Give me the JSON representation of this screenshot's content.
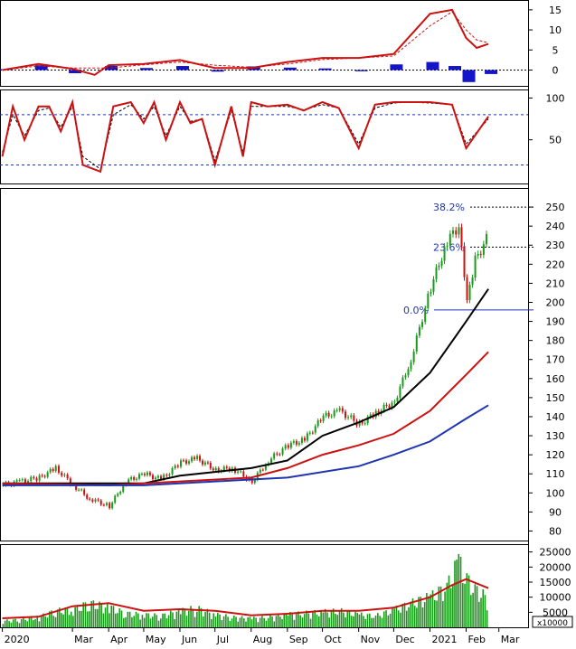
{
  "chart_data": {
    "type": "line",
    "price_panel": {
      "ylim": [
        75,
        260
      ],
      "y_ticks": [
        "80",
        "90",
        "100",
        "110",
        "120",
        "130",
        "140",
        "150",
        "160",
        "170",
        "180",
        "190",
        "200",
        "210",
        "220",
        "230",
        "240",
        "250"
      ],
      "fib_levels": [
        {
          "label": "38.2%",
          "value": 250
        },
        {
          "label": "23.6%",
          "value": 229
        },
        {
          "label": "0.0%",
          "value": 196
        }
      ],
      "candles": [
        {
          "date": "2020-01-01",
          "close": 104
        },
        {
          "date": "2020-01-15",
          "close": 106
        },
        {
          "date": "2020-02-01",
          "close": 108
        },
        {
          "date": "2020-02-15",
          "close": 113
        },
        {
          "date": "2020-03-01",
          "close": 104
        },
        {
          "date": "2020-03-15",
          "close": 97
        },
        {
          "date": "2020-04-01",
          "close": 93
        },
        {
          "date": "2020-04-15",
          "close": 106
        },
        {
          "date": "2020-05-01",
          "close": 110
        },
        {
          "date": "2020-05-15",
          "close": 107
        },
        {
          "date": "2020-06-01",
          "close": 116
        },
        {
          "date": "2020-06-15",
          "close": 118
        },
        {
          "date": "2020-07-01",
          "close": 112
        },
        {
          "date": "2020-07-15",
          "close": 113
        },
        {
          "date": "2020-08-01",
          "close": 106
        },
        {
          "date": "2020-08-15",
          "close": 117
        },
        {
          "date": "2020-09-01",
          "close": 125
        },
        {
          "date": "2020-09-15",
          "close": 128
        },
        {
          "date": "2020-10-01",
          "close": 140
        },
        {
          "date": "2020-10-15",
          "close": 143
        },
        {
          "date": "2020-11-01",
          "close": 136
        },
        {
          "date": "2020-11-15",
          "close": 142
        },
        {
          "date": "2020-12-01",
          "close": 148
        },
        {
          "date": "2020-12-15",
          "close": 170
        },
        {
          "date": "2021-01-01",
          "close": 208
        },
        {
          "date": "2021-01-15",
          "close": 232
        },
        {
          "date": "2021-01-25",
          "close": 240
        },
        {
          "date": "2021-02-01",
          "close": 200
        },
        {
          "date": "2021-02-08",
          "close": 222
        },
        {
          "date": "2021-02-20",
          "close": 236
        }
      ],
      "ma_series": [
        {
          "color": "#000000",
          "points": [
            [
              "2020-01-01",
              105
            ],
            [
              "2020-03-01",
              105
            ],
            [
              "2020-05-01",
              105
            ],
            [
              "2020-06-01",
              109
            ],
            [
              "2020-07-01",
              111
            ],
            [
              "2020-08-01",
              113
            ],
            [
              "2020-09-01",
              117
            ],
            [
              "2020-10-01",
              130
            ],
            [
              "2020-11-01",
              137
            ],
            [
              "2020-12-01",
              145
            ],
            [
              "2021-01-01",
              163
            ],
            [
              "2021-02-01",
              190
            ],
            [
              "2021-02-20",
              207
            ]
          ]
        },
        {
          "color": "#cc1111",
          "points": [
            [
              "2020-01-01",
              105
            ],
            [
              "2020-04-01",
              104
            ],
            [
              "2020-06-01",
              106
            ],
            [
              "2020-08-01",
              108
            ],
            [
              "2020-09-01",
              113
            ],
            [
              "2020-10-01",
              120
            ],
            [
              "2020-11-01",
              125
            ],
            [
              "2020-12-01",
              131
            ],
            [
              "2021-01-01",
              143
            ],
            [
              "2021-02-01",
              162
            ],
            [
              "2021-02-20",
              174
            ]
          ]
        },
        {
          "color": "#1f35b0",
          "points": [
            [
              "2020-01-01",
              104
            ],
            [
              "2020-05-01",
              104
            ],
            [
              "2020-07-01",
              106
            ],
            [
              "2020-09-01",
              108
            ],
            [
              "2020-11-01",
              114
            ],
            [
              "2020-12-01",
              120
            ],
            [
              "2021-01-01",
              127
            ],
            [
              "2021-02-01",
              139
            ],
            [
              "2021-02-20",
              146
            ]
          ]
        }
      ]
    },
    "volume_panel": {
      "unit_label": "x10000",
      "ylim": [
        0,
        27000
      ],
      "y_ticks": [
        "5000",
        "10000",
        "15000",
        "20000",
        "25000"
      ],
      "bars": [
        {
          "date": "2020-01-01",
          "value": 2500
        },
        {
          "date": "2020-01-15",
          "value": 3000
        },
        {
          "date": "2020-02-01",
          "value": 4000
        },
        {
          "date": "2020-02-15",
          "value": 6500
        },
        {
          "date": "2020-03-01",
          "value": 7000
        },
        {
          "date": "2020-03-15",
          "value": 9500
        },
        {
          "date": "2020-04-01",
          "value": 8000
        },
        {
          "date": "2020-04-15",
          "value": 5500
        },
        {
          "date": "2020-05-01",
          "value": 5000
        },
        {
          "date": "2020-05-15",
          "value": 4500
        },
        {
          "date": "2020-06-01",
          "value": 6500
        },
        {
          "date": "2020-06-15",
          "value": 7500
        },
        {
          "date": "2020-07-01",
          "value": 5000
        },
        {
          "date": "2020-07-15",
          "value": 4000
        },
        {
          "date": "2020-08-01",
          "value": 3500
        },
        {
          "date": "2020-08-15",
          "value": 4000
        },
        {
          "date": "2020-09-01",
          "value": 5000
        },
        {
          "date": "2020-09-15",
          "value": 5500
        },
        {
          "date": "2020-10-01",
          "value": 6000
        },
        {
          "date": "2020-10-15",
          "value": 6500
        },
        {
          "date": "2020-11-01",
          "value": 5000
        },
        {
          "date": "2020-11-15",
          "value": 4500
        },
        {
          "date": "2020-12-01",
          "value": 7000
        },
        {
          "date": "2020-12-15",
          "value": 9500
        },
        {
          "date": "2021-01-01",
          "value": 12000
        },
        {
          "date": "2021-01-15",
          "value": 16000
        },
        {
          "date": "2021-01-25",
          "value": 26000
        },
        {
          "date": "2021-02-01",
          "value": 19000
        },
        {
          "date": "2021-02-08",
          "value": 15000
        },
        {
          "date": "2021-02-20",
          "value": 11000
        }
      ],
      "ma": [
        [
          "2020-01-01",
          3000
        ],
        [
          "2020-02-01",
          3500
        ],
        [
          "2020-03-01",
          7000
        ],
        [
          "2020-04-01",
          8000
        ],
        [
          "2020-05-01",
          5500
        ],
        [
          "2020-06-01",
          6000
        ],
        [
          "2020-07-01",
          5500
        ],
        [
          "2020-08-01",
          4000
        ],
        [
          "2020-09-01",
          4500
        ],
        [
          "2020-10-01",
          5500
        ],
        [
          "2020-11-01",
          5500
        ],
        [
          "2020-12-01",
          6500
        ],
        [
          "2021-01-01",
          10000
        ],
        [
          "2021-01-20",
          14000
        ],
        [
          "2021-02-01",
          16000
        ],
        [
          "2021-02-20",
          13000
        ]
      ]
    },
    "macd_panel": {
      "ylim": [
        -3.5,
        17
      ],
      "y_ticks": [
        "0",
        "5",
        "10",
        "15"
      ],
      "hist": [
        {
          "date": "2020-01-01",
          "value": 0.2
        },
        {
          "date": "2020-02-01",
          "value": 1.2
        },
        {
          "date": "2020-03-01",
          "value": -0.8
        },
        {
          "date": "2020-04-01",
          "value": 1.0
        },
        {
          "date": "2020-05-01",
          "value": 0.5
        },
        {
          "date": "2020-06-01",
          "value": 1.0
        },
        {
          "date": "2020-07-01",
          "value": -0.4
        },
        {
          "date": "2020-08-01",
          "value": 0.9
        },
        {
          "date": "2020-09-01",
          "value": 0.6
        },
        {
          "date": "2020-10-01",
          "value": 0.4
        },
        {
          "date": "2020-11-01",
          "value": -0.3
        },
        {
          "date": "2020-12-01",
          "value": 1.4
        },
        {
          "date": "2021-01-01",
          "value": 2.0
        },
        {
          "date": "2021-01-20",
          "value": 1.0
        },
        {
          "date": "2021-02-01",
          "value": -3.0
        },
        {
          "date": "2021-02-20",
          "value": -1.0
        }
      ],
      "macd": [
        [
          "2020-01-01",
          0
        ],
        [
          "2020-02-01",
          1.5
        ],
        [
          "2020-03-01",
          0.3
        ],
        [
          "2020-03-20",
          -1.2
        ],
        [
          "2020-04-01",
          1.2
        ],
        [
          "2020-05-01",
          1.5
        ],
        [
          "2020-06-01",
          2.5
        ],
        [
          "2020-07-01",
          0.5
        ],
        [
          "2020-08-01",
          0.5
        ],
        [
          "2020-09-01",
          2.0
        ],
        [
          "2020-10-01",
          3.0
        ],
        [
          "2020-11-01",
          3.0
        ],
        [
          "2020-12-01",
          4.0
        ],
        [
          "2021-01-01",
          14.0
        ],
        [
          "2021-01-20",
          15.0
        ],
        [
          "2021-02-01",
          8.0
        ],
        [
          "2021-02-10",
          5.5
        ],
        [
          "2021-02-20",
          6.5
        ]
      ],
      "signal": [
        [
          "2020-01-01",
          0
        ],
        [
          "2020-02-01",
          1.0
        ],
        [
          "2020-03-01",
          0.5
        ],
        [
          "2020-04-01",
          0.5
        ],
        [
          "2020-05-01",
          1.3
        ],
        [
          "2020-06-01",
          2.0
        ],
        [
          "2020-07-01",
          1.2
        ],
        [
          "2020-08-01",
          0.7
        ],
        [
          "2020-09-01",
          1.5
        ],
        [
          "2020-10-01",
          2.6
        ],
        [
          "2020-11-01",
          3.0
        ],
        [
          "2020-12-01",
          3.5
        ],
        [
          "2021-01-01",
          11.0
        ],
        [
          "2021-01-20",
          14.5
        ],
        [
          "2021-02-01",
          10.0
        ],
        [
          "2021-02-10",
          7.5
        ],
        [
          "2021-02-20",
          6.8
        ]
      ]
    },
    "stoch_panel": {
      "ylim": [
        0,
        108
      ],
      "y_ticks": [
        "50",
        "100"
      ],
      "levels": [
        80,
        20
      ],
      "k": [
        [
          "2020-01-01",
          30
        ],
        [
          "2020-01-10",
          90
        ],
        [
          "2020-01-20",
          50
        ],
        [
          "2020-02-01",
          90
        ],
        [
          "2020-02-10",
          90
        ],
        [
          "2020-02-20",
          60
        ],
        [
          "2020-03-01",
          95
        ],
        [
          "2020-03-10",
          20
        ],
        [
          "2020-03-25",
          12
        ],
        [
          "2020-04-05",
          90
        ],
        [
          "2020-04-20",
          95
        ],
        [
          "2020-05-01",
          70
        ],
        [
          "2020-05-10",
          95
        ],
        [
          "2020-05-20",
          50
        ],
        [
          "2020-06-01",
          95
        ],
        [
          "2020-06-10",
          70
        ],
        [
          "2020-06-20",
          75
        ],
        [
          "2020-07-01",
          20
        ],
        [
          "2020-07-15",
          90
        ],
        [
          "2020-07-25",
          30
        ],
        [
          "2020-08-01",
          95
        ],
        [
          "2020-08-15",
          90
        ],
        [
          "2020-09-01",
          92
        ],
        [
          "2020-09-15",
          85
        ],
        [
          "2020-10-01",
          95
        ],
        [
          "2020-10-15",
          88
        ],
        [
          "2020-11-01",
          40
        ],
        [
          "2020-11-15",
          92
        ],
        [
          "2020-12-01",
          95
        ],
        [
          "2020-12-15",
          95
        ],
        [
          "2021-01-01",
          95
        ],
        [
          "2021-01-20",
          92
        ],
        [
          "2021-02-01",
          40
        ],
        [
          "2021-02-20",
          78
        ]
      ],
      "d": [
        [
          "2020-01-01",
          35
        ],
        [
          "2020-01-10",
          80
        ],
        [
          "2020-01-20",
          55
        ],
        [
          "2020-02-01",
          85
        ],
        [
          "2020-02-10",
          88
        ],
        [
          "2020-02-20",
          65
        ],
        [
          "2020-03-01",
          90
        ],
        [
          "2020-03-10",
          30
        ],
        [
          "2020-03-25",
          15
        ],
        [
          "2020-04-05",
          80
        ],
        [
          "2020-04-20",
          92
        ],
        [
          "2020-05-01",
          75
        ],
        [
          "2020-05-10",
          90
        ],
        [
          "2020-05-20",
          55
        ],
        [
          "2020-06-01",
          90
        ],
        [
          "2020-06-10",
          72
        ],
        [
          "2020-06-20",
          75
        ],
        [
          "2020-07-01",
          25
        ],
        [
          "2020-07-15",
          85
        ],
        [
          "2020-07-25",
          35
        ],
        [
          "2020-08-01",
          90
        ],
        [
          "2020-08-15",
          90
        ],
        [
          "2020-09-01",
          90
        ],
        [
          "2020-09-15",
          86
        ],
        [
          "2020-10-01",
          92
        ],
        [
          "2020-10-15",
          88
        ],
        [
          "2020-11-01",
          45
        ],
        [
          "2020-11-15",
          88
        ],
        [
          "2020-12-01",
          94
        ],
        [
          "2020-12-15",
          95
        ],
        [
          "2021-01-01",
          94
        ],
        [
          "2021-01-20",
          92
        ],
        [
          "2021-02-01",
          45
        ],
        [
          "2021-02-20",
          75
        ]
      ]
    },
    "x_axis": {
      "xlim": [
        "2019-12-30",
        "2021-03-26"
      ],
      "labels": [
        {
          "date": "2020-01-01",
          "label": "2020"
        },
        {
          "date": "2020-03-01",
          "label": "Mar"
        },
        {
          "date": "2020-04-01",
          "label": "Apr"
        },
        {
          "date": "2020-05-01",
          "label": "May"
        },
        {
          "date": "2020-06-01",
          "label": "Jun"
        },
        {
          "date": "2020-07-01",
          "label": "Jul"
        },
        {
          "date": "2020-08-01",
          "label": "Aug"
        },
        {
          "date": "2020-09-01",
          "label": "Sep"
        },
        {
          "date": "2020-10-01",
          "label": "Oct"
        },
        {
          "date": "2020-11-01",
          "label": "Nov"
        },
        {
          "date": "2020-12-01",
          "label": "Dec"
        },
        {
          "date": "2021-01-01",
          "label": "2021"
        },
        {
          "date": "2021-02-01",
          "label": "Feb"
        },
        {
          "date": "2021-03-01",
          "label": "Mar"
        }
      ]
    }
  }
}
